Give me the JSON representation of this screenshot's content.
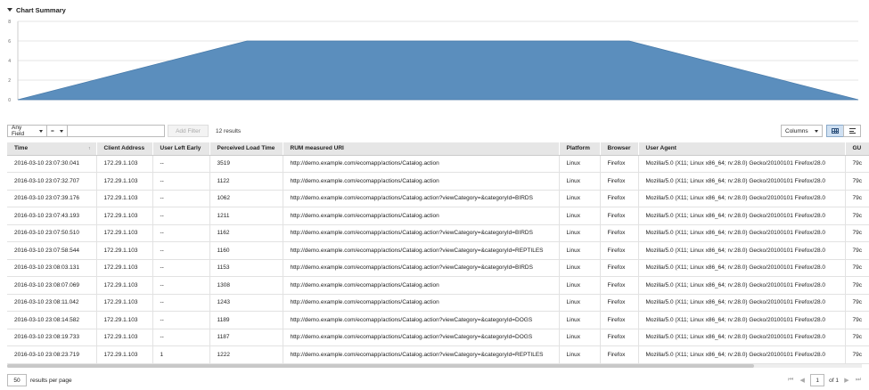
{
  "summary": {
    "title": "Chart Summary"
  },
  "chart_data": {
    "type": "area",
    "x": [
      0,
      1,
      2,
      3,
      4,
      5,
      6,
      7,
      8,
      9,
      10,
      11
    ],
    "values": [
      0,
      2,
      4,
      6,
      6,
      6,
      6,
      6,
      6,
      4,
      2,
      0
    ],
    "ylim": [
      0,
      8
    ],
    "yticks": [
      "0",
      "2",
      "4",
      "6",
      "8"
    ],
    "grid": true,
    "color": "#5b8ebd"
  },
  "filter": {
    "field_label": "Any Field",
    "operator_label": "=",
    "input_value": "",
    "add_filter_label": "Add Filter",
    "results_text": "12 results"
  },
  "toolbar": {
    "columns_label": "Columns"
  },
  "table": {
    "columns": [
      "Time",
      "Client Address",
      "User Left Early",
      "Perceived Load Time",
      "RUM measured URI",
      "Platform",
      "Browser",
      "User Agent",
      "GU"
    ],
    "sort_indicator": "↑",
    "rows": [
      [
        "2016-03-10 23:07:30.041",
        "172.29.1.103",
        "--",
        "3519",
        "http://demo.example.com/ecomapp/actions/Catalog.action",
        "Linux",
        "Firefox",
        "Mozilla/5.0 (X11; Linux x86_64; rv:28.0) Gecko/20100101 Firefox/28.0",
        "79c"
      ],
      [
        "2016-03-10 23:07:32.707",
        "172.29.1.103",
        "--",
        "1122",
        "http://demo.example.com/ecomapp/actions/Catalog.action",
        "Linux",
        "Firefox",
        "Mozilla/5.0 (X11; Linux x86_64; rv:28.0) Gecko/20100101 Firefox/28.0",
        "79c"
      ],
      [
        "2016-03-10 23:07:39.176",
        "172.29.1.103",
        "--",
        "1062",
        "http://demo.example.com/ecomapp/actions/Catalog.action?viewCategory=&categoryId=BIRDS",
        "Linux",
        "Firefox",
        "Mozilla/5.0 (X11; Linux x86_64; rv:28.0) Gecko/20100101 Firefox/28.0",
        "79c"
      ],
      [
        "2016-03-10 23:07:43.193",
        "172.29.1.103",
        "--",
        "1211",
        "http://demo.example.com/ecomapp/actions/Catalog.action",
        "Linux",
        "Firefox",
        "Mozilla/5.0 (X11; Linux x86_64; rv:28.0) Gecko/20100101 Firefox/28.0",
        "79c"
      ],
      [
        "2016-03-10 23:07:50.510",
        "172.29.1.103",
        "--",
        "1162",
        "http://demo.example.com/ecomapp/actions/Catalog.action?viewCategory=&categoryId=BIRDS",
        "Linux",
        "Firefox",
        "Mozilla/5.0 (X11; Linux x86_64; rv:28.0) Gecko/20100101 Firefox/28.0",
        "79c"
      ],
      [
        "2016-03-10 23:07:58.544",
        "172.29.1.103",
        "--",
        "1160",
        "http://demo.example.com/ecomapp/actions/Catalog.action?viewCategory=&categoryId=REPTILES",
        "Linux",
        "Firefox",
        "Mozilla/5.0 (X11; Linux x86_64; rv:28.0) Gecko/20100101 Firefox/28.0",
        "79c"
      ],
      [
        "2016-03-10 23:08:03.131",
        "172.29.1.103",
        "--",
        "1153",
        "http://demo.example.com/ecomapp/actions/Catalog.action?viewCategory=&categoryId=BIRDS",
        "Linux",
        "Firefox",
        "Mozilla/5.0 (X11; Linux x86_64; rv:28.0) Gecko/20100101 Firefox/28.0",
        "79c"
      ],
      [
        "2016-03-10 23:08:07.069",
        "172.29.1.103",
        "--",
        "1308",
        "http://demo.example.com/ecomapp/actions/Catalog.action",
        "Linux",
        "Firefox",
        "Mozilla/5.0 (X11; Linux x86_64; rv:28.0) Gecko/20100101 Firefox/28.0",
        "79c"
      ],
      [
        "2016-03-10 23:08:11.042",
        "172.29.1.103",
        "--",
        "1243",
        "http://demo.example.com/ecomapp/actions/Catalog.action",
        "Linux",
        "Firefox",
        "Mozilla/5.0 (X11; Linux x86_64; rv:28.0) Gecko/20100101 Firefox/28.0",
        "79c"
      ],
      [
        "2016-03-10 23:08:14.582",
        "172.29.1.103",
        "--",
        "1189",
        "http://demo.example.com/ecomapp/actions/Catalog.action?viewCategory=&categoryId=DOGS",
        "Linux",
        "Firefox",
        "Mozilla/5.0 (X11; Linux x86_64; rv:28.0) Gecko/20100101 Firefox/28.0",
        "79c"
      ],
      [
        "2016-03-10 23:08:19.733",
        "172.29.1.103",
        "--",
        "1187",
        "http://demo.example.com/ecomapp/actions/Catalog.action?viewCategory=&categoryId=DOGS",
        "Linux",
        "Firefox",
        "Mozilla/5.0 (X11; Linux x86_64; rv:28.0) Gecko/20100101 Firefox/28.0",
        "79c"
      ],
      [
        "2016-03-10 23:08:23.719",
        "172.29.1.103",
        "1",
        "1222",
        "http://demo.example.com/ecomapp/actions/Catalog.action?viewCategory=&categoryId=REPTILES",
        "Linux",
        "Firefox",
        "Mozilla/5.0 (X11; Linux x86_64; rv:28.0) Gecko/20100101 Firefox/28.0",
        "79c"
      ]
    ]
  },
  "footer": {
    "per_page_value": "50",
    "per_page_label": "results per page",
    "page_value": "1",
    "page_total_label": "of 1"
  },
  "icons": {
    "collapse": "caret-down-icon",
    "grid_view": "grid-view-icon",
    "list_view": "list-view-icon",
    "first_page": "first-page-icon",
    "prev_page": "prev-page-icon",
    "next_page": "next-page-icon",
    "last_page": "last-page-icon"
  }
}
